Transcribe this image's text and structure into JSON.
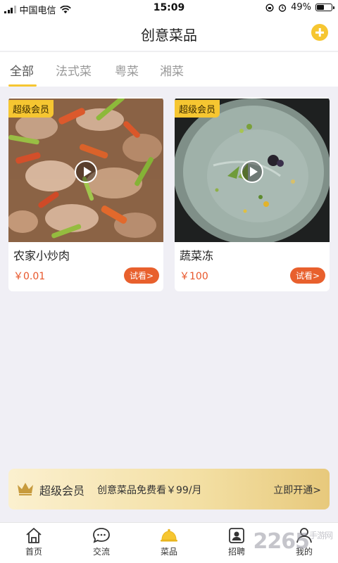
{
  "status": {
    "carrier": "中国电信",
    "time": "15:09",
    "battery": "49%",
    "battery_level": 0.49
  },
  "header": {
    "title": "创意菜品"
  },
  "tabs": [
    {
      "label": "全部",
      "active": true
    },
    {
      "label": "法式菜",
      "active": false
    },
    {
      "label": "粤菜",
      "active": false
    },
    {
      "label": "湘菜",
      "active": false
    }
  ],
  "dishes": [
    {
      "badge": "超级会员",
      "title": "农家小炒肉",
      "price": "￥0.01",
      "action": "试看>"
    },
    {
      "badge": "超级会员",
      "title": "蔬菜冻",
      "price": "￥100",
      "action": "试看>"
    }
  ],
  "member": {
    "title": "超级会员",
    "desc": "创意菜品免费看￥99/月",
    "cta": "立即开通>"
  },
  "tabbar": [
    {
      "label": "首页",
      "icon": "home-icon"
    },
    {
      "label": "交流",
      "icon": "chat-icon"
    },
    {
      "label": "菜品",
      "icon": "dish-cover-icon",
      "active": true
    },
    {
      "label": "招聘",
      "icon": "recruit-icon"
    },
    {
      "label": "我的",
      "icon": "user-icon"
    }
  ],
  "colors": {
    "accent": "#f6c631",
    "price": "#e8562a",
    "button": "#e8602d"
  },
  "watermark": {
    "text": "2265",
    "sub": "手游网"
  }
}
